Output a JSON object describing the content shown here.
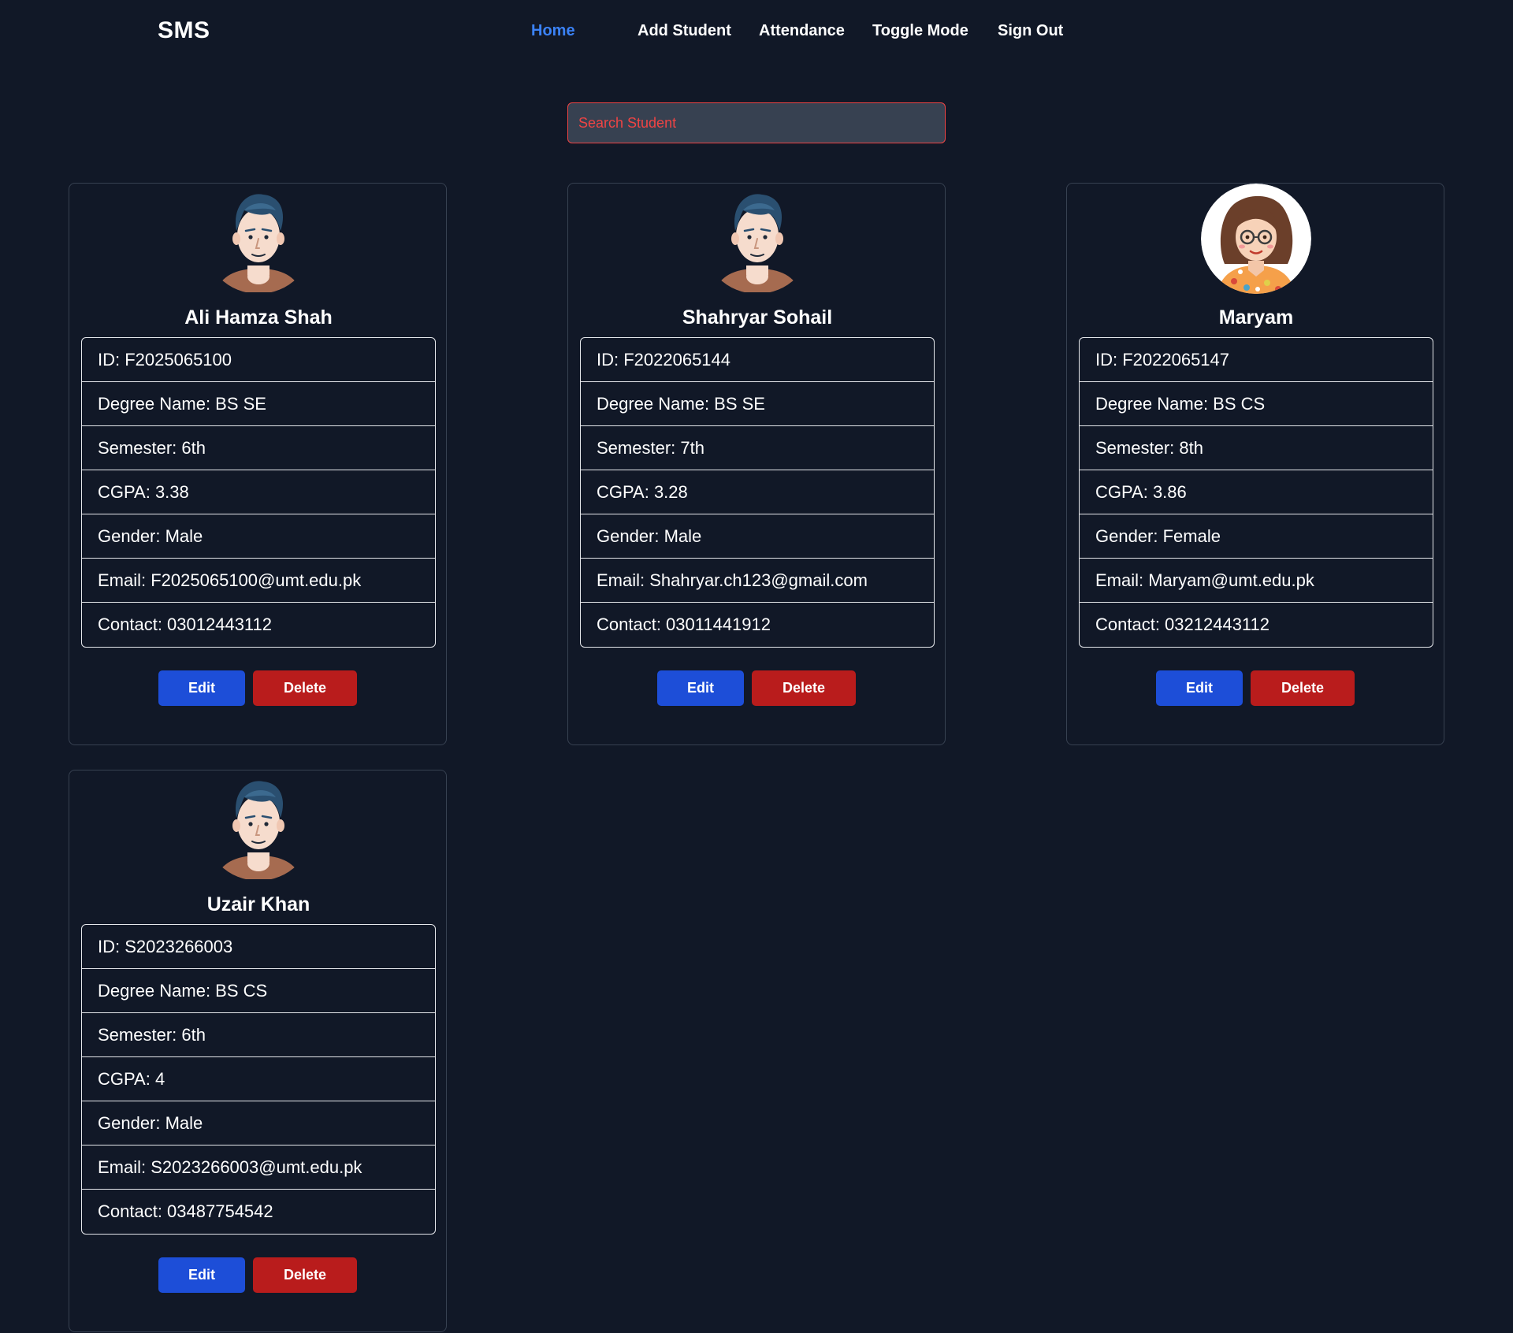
{
  "nav": {
    "logo": "SMS",
    "links": [
      "Home",
      "Add Student",
      "Attendance",
      "Toggle Mode",
      "Sign Out"
    ]
  },
  "search": {
    "placeholder": "Search Student",
    "value": ""
  },
  "colors": {
    "background": "#111827",
    "active_link": "#3b82f6",
    "search_accent": "#ef4444",
    "edit_button": "#1d4ed8",
    "delete_button": "#b91c1c"
  },
  "students": [
    {
      "name": "Ali Hamza Shah",
      "avatar": "male-avatar-icon",
      "fields": [
        "ID: F2025065100",
        "Degree Name: BS SE",
        "Semester: 6th",
        "CGPA: 3.38",
        "Gender: Male",
        "Email: F2025065100@umt.edu.pk",
        "Contact: 03012443112"
      ],
      "edit_label": "Edit",
      "delete_label": "Delete"
    },
    {
      "name": "Shahryar Sohail",
      "avatar": "male-avatar-icon",
      "fields": [
        "ID: F2022065144",
        "Degree Name: BS SE",
        "Semester: 7th",
        "CGPA: 3.28",
        "Gender: Male",
        "Email: Shahryar.ch123@gmail.com",
        "Contact: 03011441912"
      ],
      "edit_label": "Edit",
      "delete_label": "Delete"
    },
    {
      "name": "Maryam",
      "avatar": "female-avatar-icon",
      "fields": [
        "ID: F2022065147",
        "Degree Name: BS CS",
        "Semester: 8th",
        "CGPA: 3.86",
        "Gender: Female",
        "Email: Maryam@umt.edu.pk",
        "Contact: 03212443112"
      ],
      "edit_label": "Edit",
      "delete_label": "Delete"
    },
    {
      "name": "Uzair Khan",
      "avatar": "male-avatar-icon",
      "fields": [
        "ID: S2023266003",
        "Degree Name: BS CS",
        "Semester: 6th",
        "CGPA: 4",
        "Gender: Male",
        "Email: S2023266003@umt.edu.pk",
        "Contact: 03487754542"
      ],
      "edit_label": "Edit",
      "delete_label": "Delete"
    }
  ]
}
